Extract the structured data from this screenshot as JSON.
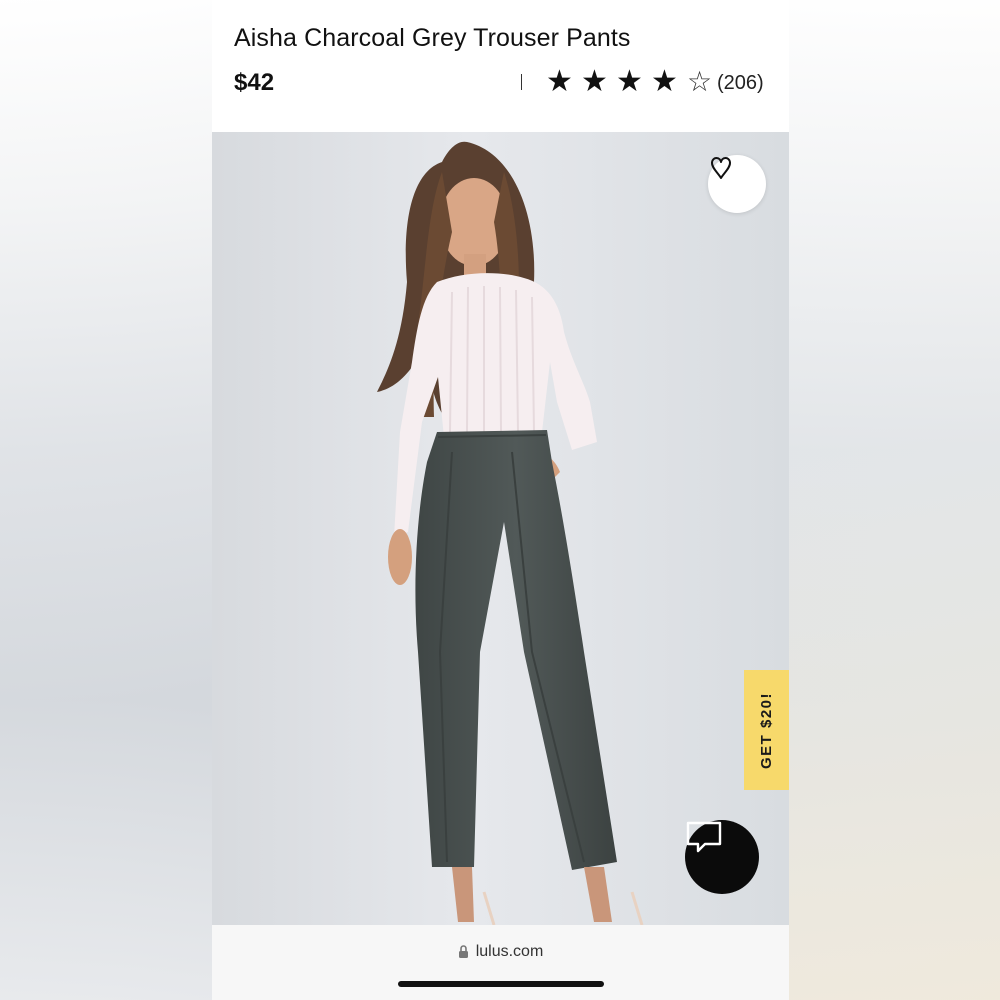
{
  "product": {
    "title": "Aisha Charcoal Grey Trouser Pants",
    "price": "$42",
    "rating": 4,
    "rating_max": 5,
    "review_count": "(206)"
  },
  "icons": {
    "wishlist": "heart-outline-icon",
    "chat": "chat-bubble-icon",
    "lock": "lock-icon",
    "star_filled": "star-filled-icon",
    "star_empty": "star-outline-icon"
  },
  "promo": {
    "label": "GET $20!"
  },
  "browser": {
    "url": "lulus.com"
  },
  "colors": {
    "promo_background": "#f7d96b",
    "chat_background": "#0b0b0b",
    "text_primary": "#111111",
    "trousers": "#4a5150"
  }
}
